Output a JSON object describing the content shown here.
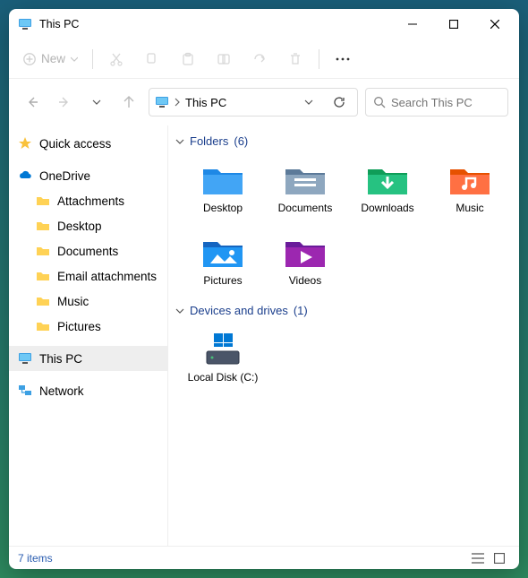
{
  "titlebar": {
    "title": "This PC"
  },
  "toolbar": {
    "new_label": "New"
  },
  "address": {
    "crumb": "This PC"
  },
  "search": {
    "placeholder": "Search This PC"
  },
  "sidebar": {
    "quick_access": "Quick access",
    "onedrive": "OneDrive",
    "onedrive_items": [
      {
        "label": "Attachments"
      },
      {
        "label": "Desktop"
      },
      {
        "label": "Documents"
      },
      {
        "label": "Email attachments"
      },
      {
        "label": "Music"
      },
      {
        "label": "Pictures"
      }
    ],
    "this_pc": "This PC",
    "network": "Network"
  },
  "sections": {
    "folders": {
      "label": "Folders",
      "count": "(6)"
    },
    "devices": {
      "label": "Devices and drives",
      "count": "(1)"
    }
  },
  "folders": [
    {
      "label": "Desktop"
    },
    {
      "label": "Documents"
    },
    {
      "label": "Downloads"
    },
    {
      "label": "Music"
    },
    {
      "label": "Pictures"
    },
    {
      "label": "Videos"
    }
  ],
  "drives": [
    {
      "label": "Local Disk (C:)"
    }
  ],
  "statusbar": {
    "text": "7 items"
  }
}
